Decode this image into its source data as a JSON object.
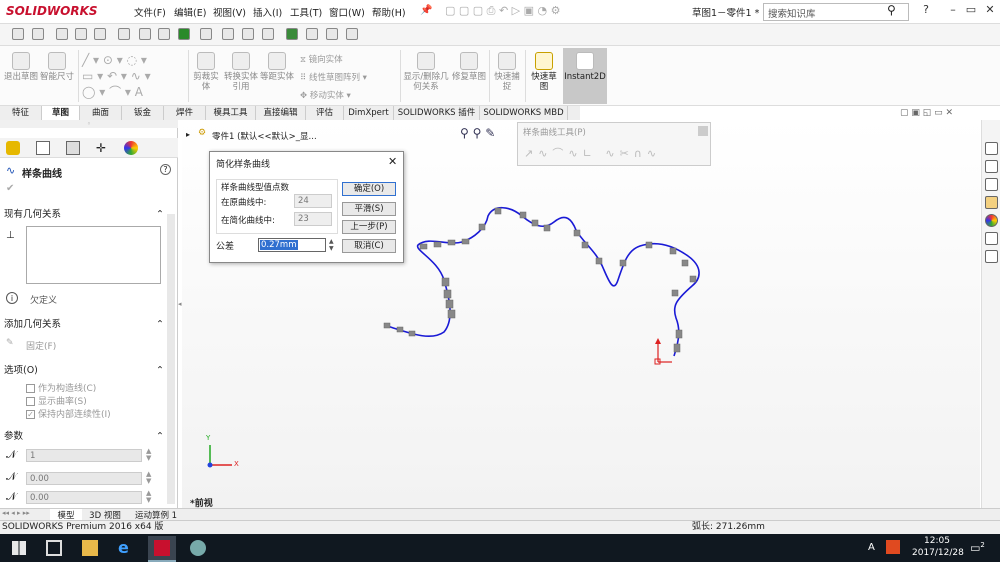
{
  "app": {
    "logo": "SOLIDWORKS",
    "doc_title": "草图1－零件1 *",
    "search_placeholder": "搜索知识库"
  },
  "menu": [
    "文件(F)",
    "编辑(E)",
    "视图(V)",
    "插入(I)",
    "工具(T)",
    "窗口(W)",
    "帮助(H)"
  ],
  "ribbon": [
    "退出草图",
    "智能尺寸",
    "剪裁实体",
    "转换实体引用",
    "等距实体",
    "镜向实体",
    "线性草图阵列",
    "移动实体",
    "显示/删除几何关系",
    "修复草图",
    "快速捕捉",
    "快速草图",
    "Instant2D"
  ],
  "tabs": [
    "特征",
    "草图",
    "曲面",
    "钣金",
    "焊件",
    "模具工具",
    "直接编辑",
    "评估",
    "DimXpert",
    "SOLIDWORKS 插件",
    "SOLIDWORKS MBD"
  ],
  "active_tab": "草图",
  "tree_crumb": "零件1 (默认<<默认>_显...",
  "panel": {
    "title": "样条曲线",
    "existing_relations": "现有几何关系",
    "undefined": "欠定义",
    "add_relations": "添加几何关系",
    "fix": "固定(F)",
    "options": "选项(O)",
    "opt1": "作为构造线(C)",
    "opt2": "显示曲率(S)",
    "opt3": "保持内部连续性(I)",
    "params": "参数",
    "p1": "1",
    "p2": "0.00",
    "p3": "0.00"
  },
  "dialog": {
    "title": "简化样条曲线",
    "group": "样条曲线型值点数",
    "orig_label": "在原曲线中:",
    "orig_val": "24",
    "simp_label": "在简化曲线中:",
    "simp_val": "23",
    "tol_label": "公差",
    "tol_val": "0.27mm",
    "ok": "确定(O)",
    "smooth": "平滑(S)",
    "prev": "上一步(P)",
    "cancel": "取消(C)"
  },
  "spline_tools_title": "样条曲线工具(P)",
  "view_label": "*前视",
  "bottom_tabs": [
    "模型",
    "3D 视图",
    "运动算例 1"
  ],
  "status": {
    "left": "SOLIDWORKS Premium 2016 x64 版",
    "arc": "弧长: 271.26mm"
  },
  "taskbar": {
    "time": "12:05",
    "date": "2017/12/28",
    "ime": "A",
    "notif": "2"
  },
  "colors": {
    "spline": "#1a1ad6",
    "accent": "#c8102e"
  }
}
